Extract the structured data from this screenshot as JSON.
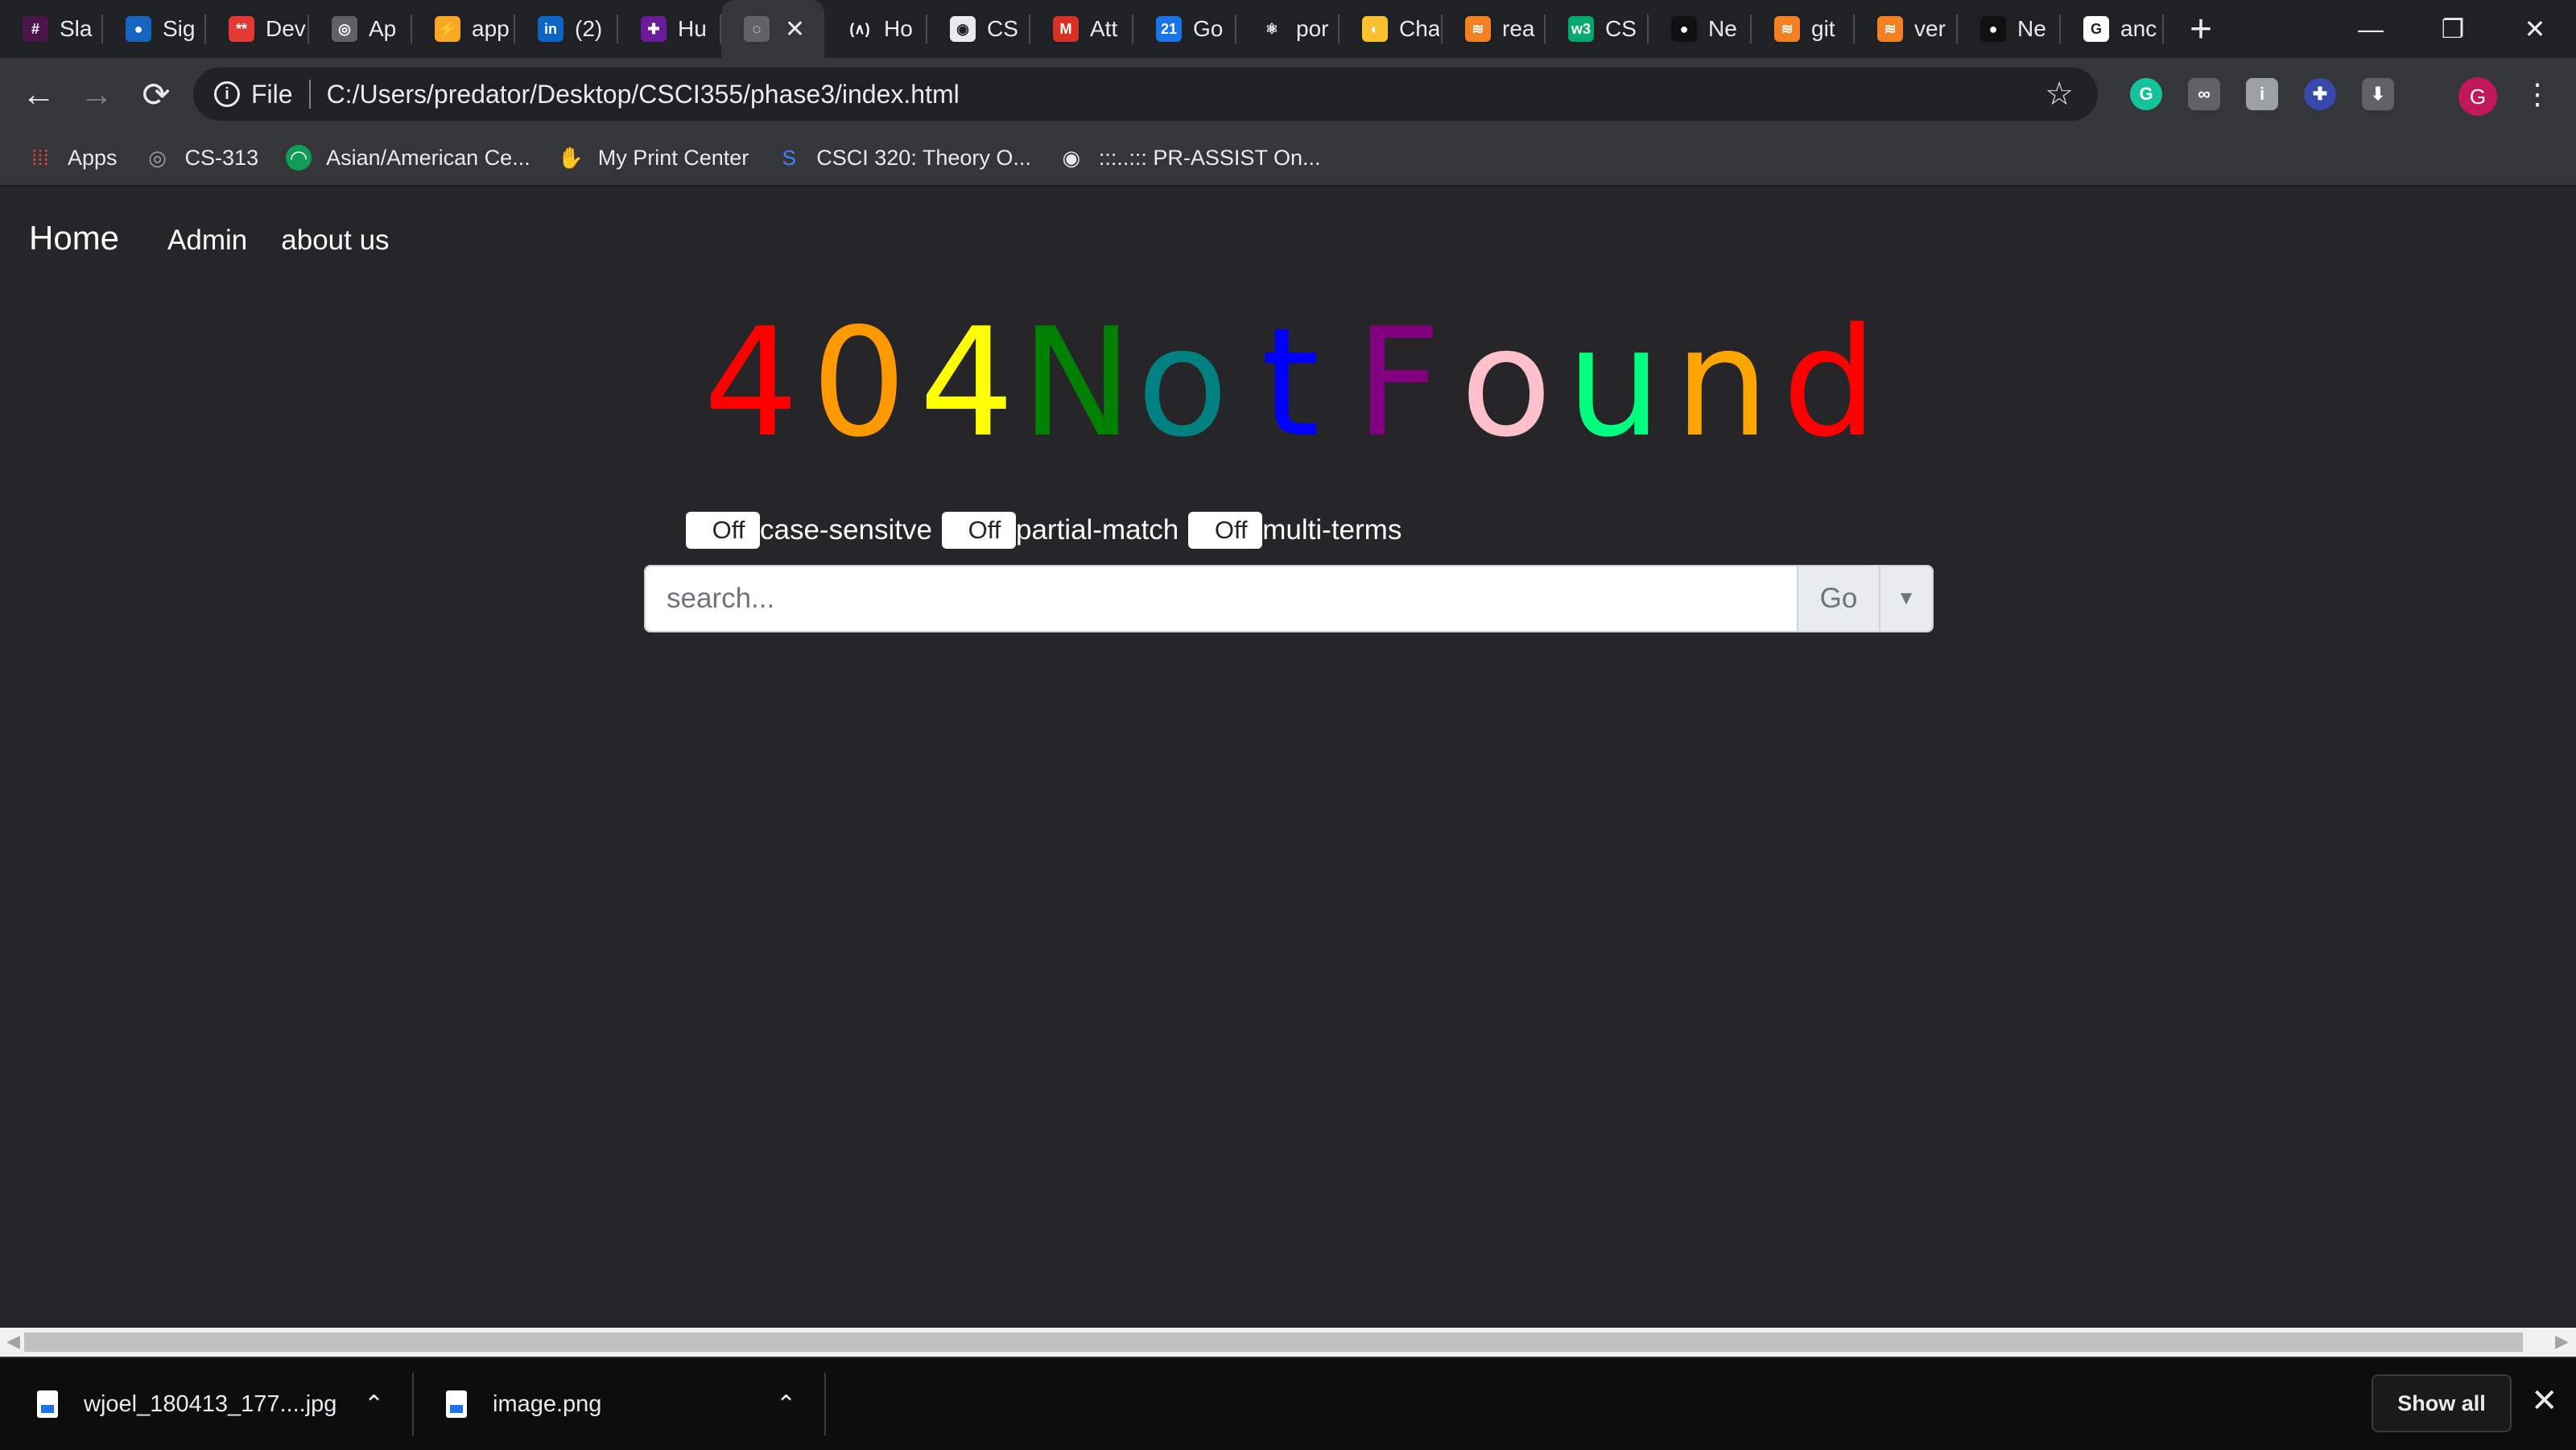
{
  "tabs": [
    {
      "label": "Sla",
      "fav_text": "#",
      "fav_color": "#4a154b"
    },
    {
      "label": "Sig",
      "fav_text": "●",
      "fav_color": "#1565c0"
    },
    {
      "label": "Dev",
      "fav_text": "**",
      "fav_color": "#e53935"
    },
    {
      "label": "Ap",
      "fav_text": "◎",
      "fav_color": "#5f6368"
    },
    {
      "label": "app",
      "fav_text": "⚡",
      "fav_color": "#f9a825"
    },
    {
      "label": "(2)",
      "fav_text": "in",
      "fav_color": "#0a66c2"
    },
    {
      "label": "Hu",
      "fav_text": "✚",
      "fav_color": "#6a1b9a"
    },
    {
      "label": "",
      "fav_text": "◌",
      "fav_color": "#5f6368",
      "active": true
    },
    {
      "label": "Ho",
      "fav_text": "(∧)",
      "fav_color": "#202124"
    },
    {
      "label": "CS",
      "fav_text": "◉",
      "fav_color": "#e8eaed"
    },
    {
      "label": "Att",
      "fav_text": "M",
      "fav_color": "#d93025"
    },
    {
      "label": "Go",
      "fav_text": "21",
      "fav_color": "#1a73e8"
    },
    {
      "label": "por",
      "fav_text": "⚛",
      "fav_color": "#202124"
    },
    {
      "label": "Cha",
      "fav_text": "◐",
      "fav_color": "#fbc02d"
    },
    {
      "label": "rea",
      "fav_text": "≋",
      "fav_color": "#f48024"
    },
    {
      "label": "CS",
      "fav_text": "w3",
      "fav_color": "#04aa6d"
    },
    {
      "label": "Ne",
      "fav_text": "●",
      "fav_color": "#111111"
    },
    {
      "label": "git",
      "fav_text": "≋",
      "fav_color": "#f48024"
    },
    {
      "label": "ver",
      "fav_text": "≋",
      "fav_color": "#f48024"
    },
    {
      "label": "Ne",
      "fav_text": "●",
      "fav_color": "#111111"
    },
    {
      "label": "anc",
      "fav_text": "G",
      "fav_color": "#ffffff"
    }
  ],
  "window": {
    "minimize": "—",
    "restore": "❐",
    "close": "✕"
  },
  "toolbar": {
    "back": "←",
    "forward": "→",
    "reload": "⟳",
    "scheme": "File",
    "url": "C:/Users/predator/Desktop/CSCI355/phase3/index.html",
    "star": "☆",
    "avatar_letter": "G",
    "menu": "⋮"
  },
  "bookmarks": [
    {
      "label": "Apps",
      "icon": "apps-grid-icon"
    },
    {
      "label": "CS-313",
      "icon": "swirl-icon"
    },
    {
      "label": "Asian/American Ce...",
      "icon": "green-circle-icon"
    },
    {
      "label": "My Print Center",
      "icon": "hand-icon"
    },
    {
      "label": "CSCI 320: Theory O...",
      "icon": "s-logo-icon"
    },
    {
      "label": ":::..::: PR-ASSIST On...",
      "icon": "globe-icon"
    }
  ],
  "nav": {
    "home": "Home",
    "admin": "Admin",
    "about": "about us"
  },
  "hero": {
    "letters": [
      "4",
      "0",
      "4",
      "N",
      "o",
      "t",
      "F",
      "o",
      "u",
      "n",
      "d"
    ],
    "colors": [
      "#ff0000",
      "#ff9900",
      "#ffff00",
      "#008000",
      "#008080",
      "#0000ff",
      "#800080",
      "#ffc0cb",
      "#00ff7f",
      "#ffa500",
      "#ff0000"
    ]
  },
  "toggles": [
    {
      "state": "Off",
      "label": "case-sensitve"
    },
    {
      "state": "Off",
      "label": "partial-match"
    },
    {
      "state": "Off",
      "label": "multi-terms"
    }
  ],
  "search": {
    "placeholder": "search...",
    "go_label": "Go"
  },
  "downloads": {
    "items": [
      {
        "name": "wjoel_180413_177....jpg"
      },
      {
        "name": "image.png"
      }
    ],
    "show_all": "Show all"
  }
}
